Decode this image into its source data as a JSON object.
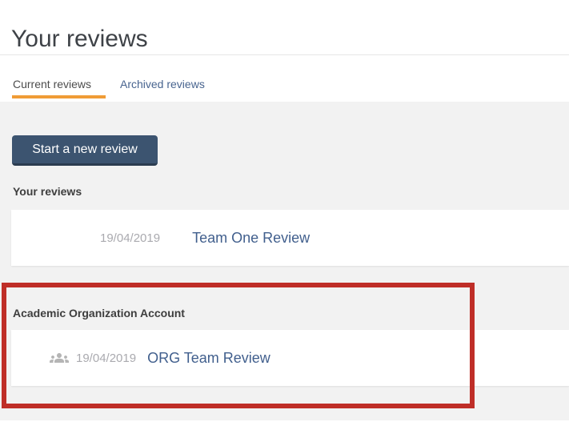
{
  "page": {
    "title": "Your reviews"
  },
  "tabs": {
    "current": {
      "label": "Current reviews",
      "active": true
    },
    "archived": {
      "label": "Archived reviews",
      "active": false
    }
  },
  "toolbar": {
    "new_review_label": "Start a new review"
  },
  "sections": {
    "personal": {
      "heading": "Your reviews",
      "rows": [
        {
          "date": "19/04/2019",
          "name": "Team One Review"
        }
      ]
    },
    "organization": {
      "heading": "Academic Organization Account",
      "highlighted": true,
      "rows": [
        {
          "date": "19/04/2019",
          "name": "ORG Team Review",
          "icon": "group-icon"
        }
      ]
    }
  },
  "annotations": {
    "highlight_rectangle_color": "#bf2e28"
  },
  "colors": {
    "tab_active_underline": "#f09c36",
    "button_background": "#3c5470",
    "link_blue": "#415f8d",
    "date_gray": "#aaaaaf",
    "content_background": "#f2f2f2",
    "divider": "#e6e6e6"
  }
}
